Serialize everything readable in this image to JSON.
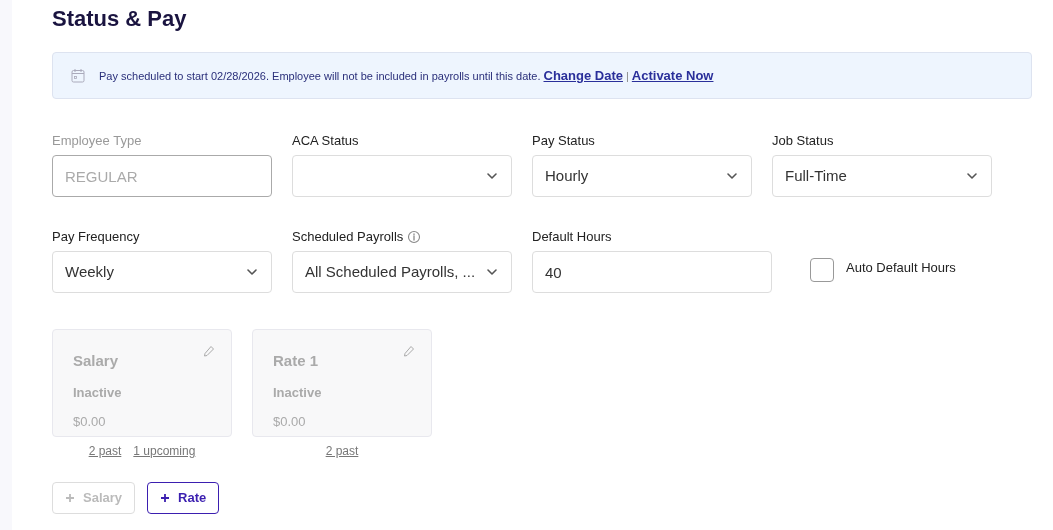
{
  "heading": "Status & Pay",
  "banner": {
    "text": "Pay scheduled to start 02/28/2026. Employee will not be included in payrolls until this date.",
    "links": [
      "Change Date",
      "Activate Now"
    ],
    "separator": "|"
  },
  "fields": [
    {
      "kind": "text",
      "label": "Employee Type",
      "value": "REGULAR",
      "disabled": true
    },
    {
      "kind": "select",
      "label": "ACA Status"
    },
    {
      "kind": "select",
      "label": "Pay Status",
      "value": "Hourly"
    },
    {
      "kind": "select",
      "label": "Job Status",
      "value": "Full-Time"
    },
    {
      "kind": "select",
      "label": "Pay Frequency",
      "value": "Weekly"
    },
    {
      "kind": "select",
      "label": "Scheduled Payrolls",
      "value": "All Scheduled Payrolls, ...",
      "info": true
    },
    {
      "kind": "text",
      "label": "Default Hours",
      "value": "40"
    },
    {
      "kind": "checkbox",
      "label": "Auto Default Hours",
      "checked": false
    }
  ],
  "cards": [
    {
      "title": "Salary",
      "status": "Inactive",
      "amount": "$0.00",
      "links": [
        "2 past",
        "1 upcoming"
      ]
    },
    {
      "title": "Rate 1",
      "status": "Inactive",
      "amount": "$0.00",
      "links": [
        "2 past"
      ]
    }
  ],
  "buttons": [
    {
      "label": "Salary",
      "disabled": true
    },
    {
      "label": "Rate",
      "disabled": false
    }
  ]
}
